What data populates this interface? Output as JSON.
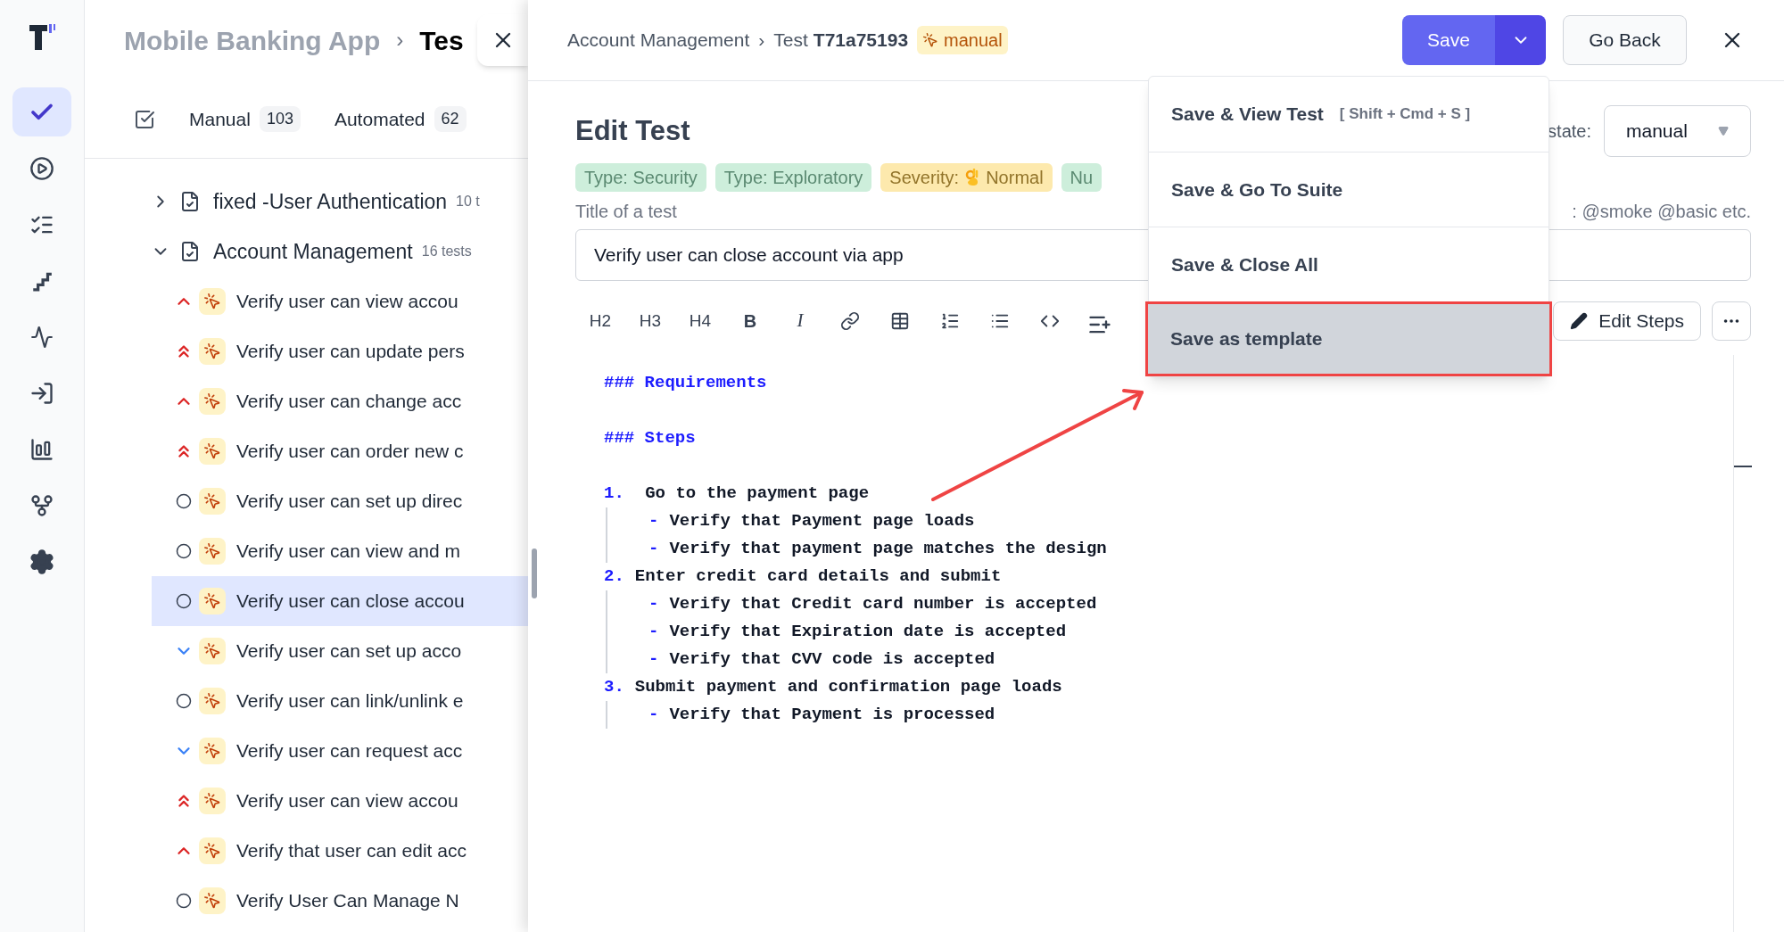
{
  "rail": {
    "items": [
      {
        "kind": "check",
        "selected": true
      },
      {
        "kind": "play",
        "selected": false
      },
      {
        "kind": "list",
        "selected": false
      },
      {
        "kind": "steps",
        "selected": false
      },
      {
        "kind": "pulse",
        "selected": false
      },
      {
        "kind": "import",
        "selected": false
      },
      {
        "kind": "analytics",
        "selected": false
      },
      {
        "kind": "branch",
        "selected": false
      },
      {
        "kind": "settings",
        "selected": false
      }
    ]
  },
  "left": {
    "breadcrumb": {
      "project": "Mobile Banking App",
      "separator": "›",
      "current": "Tes"
    },
    "tabs": [
      {
        "label": "Manual",
        "count": "103"
      },
      {
        "label": "Automated",
        "count": "62"
      }
    ],
    "tree": [
      {
        "name": "fixed -User Authentication",
        "count": "10 t",
        "expanded": false
      },
      {
        "name": "Account Management",
        "count": "16 tests",
        "expanded": true,
        "children": [
          {
            "name": "Verify user can view accou",
            "kind": "high",
            "selected": false
          },
          {
            "name": "Verify user can update pers",
            "kind": "critical",
            "selected": false
          },
          {
            "name": "Verify user can change acc",
            "kind": "high",
            "selected": false
          },
          {
            "name": "Verify user can order new c",
            "kind": "critical",
            "selected": false
          },
          {
            "name": "Verify user can set up direc",
            "kind": "normal",
            "selected": false
          },
          {
            "name": "Verify user can view and m",
            "kind": "normal",
            "selected": false
          },
          {
            "name": "Verify user can close accou",
            "kind": "normal",
            "selected": true
          },
          {
            "name": "Verify user can set up acco",
            "kind": "low",
            "selected": false
          },
          {
            "name": "Verify user can link/unlink e",
            "kind": "normal",
            "selected": false
          },
          {
            "name": "Verify user can request acc",
            "kind": "low",
            "selected": false
          },
          {
            "name": "Verify user can view accou",
            "kind": "critical",
            "selected": false
          },
          {
            "name": "Verify that user can edit acc",
            "kind": "high",
            "selected": false
          },
          {
            "name": "Verify User Can Manage N",
            "kind": "normal",
            "selected": false
          }
        ]
      }
    ]
  },
  "header": {
    "breadcrumb": {
      "suite": "Account Management",
      "separator": "›",
      "test_prefix": "Test",
      "test_id": "T71a75193",
      "badge": "manual"
    },
    "save_button": "Save",
    "go_back_button": "Go Back"
  },
  "save_menu": [
    {
      "label": "Save & View Test",
      "shortcut": "[ Shift + Cmd + S ]",
      "highlighted": false
    },
    {
      "label": "Save & Go To Suite",
      "highlighted": false
    },
    {
      "label": "Save & Close All",
      "highlighted": false
    },
    {
      "label": "Save as template",
      "highlighted": true
    }
  ],
  "form": {
    "title": "Edit Test",
    "state_label": "state:",
    "state_value": "manual",
    "tags": [
      {
        "label": "Type: Security",
        "color": "#cdeedb"
      },
      {
        "label": "Type: Exploratory",
        "color": "#cdeedb"
      },
      {
        "kind": "severity",
        "label": "Severity:",
        "value": "Normal",
        "color": "#fde9ad"
      },
      {
        "label": "Nu",
        "color": "#cdeedb"
      }
    ],
    "title_label": "Title of a test",
    "tags_hint": ": @smoke @basic etc.",
    "title_value": "Verify user can close account via app",
    "toolbar": [
      {
        "kind": "heading",
        "label": "H2"
      },
      {
        "kind": "heading",
        "label": "H3"
      },
      {
        "kind": "heading",
        "label": "H4"
      },
      {
        "kind": "bold",
        "label": "B"
      },
      {
        "kind": "italic",
        "label": "I"
      },
      {
        "kind": "link"
      },
      {
        "kind": "table"
      },
      {
        "kind": "ordered-list"
      },
      {
        "kind": "bullet-list"
      },
      {
        "kind": "code"
      },
      {
        "kind": "list-add"
      }
    ],
    "edit_steps_button": "Edit Steps"
  },
  "editor": {
    "sections": [
      {
        "heading": "### Requirements"
      },
      {
        "heading": "### Steps",
        "steps": [
          {
            "marker": "1.",
            "text": " Go to the payment page",
            "children": [
              {
                "marker": "-",
                "text": "Verify that Payment page loads"
              },
              {
                "marker": "-",
                "text": "Verify that payment page matches the design"
              }
            ]
          },
          {
            "marker": "2.",
            "text": "Enter credit card details and submit",
            "children": [
              {
                "marker": "-",
                "text": "Verify that Credit card number is accepted"
              },
              {
                "marker": "-",
                "text": "Verify that Expiration date is accepted"
              },
              {
                "marker": "-",
                "text": "Verify that CVV code is accepted"
              }
            ]
          },
          {
            "marker": "3.",
            "text": "Submit payment and confirmation page loads",
            "children": [
              {
                "marker": "-",
                "text": "Verify that Payment is processed"
              }
            ]
          }
        ]
      }
    ]
  }
}
